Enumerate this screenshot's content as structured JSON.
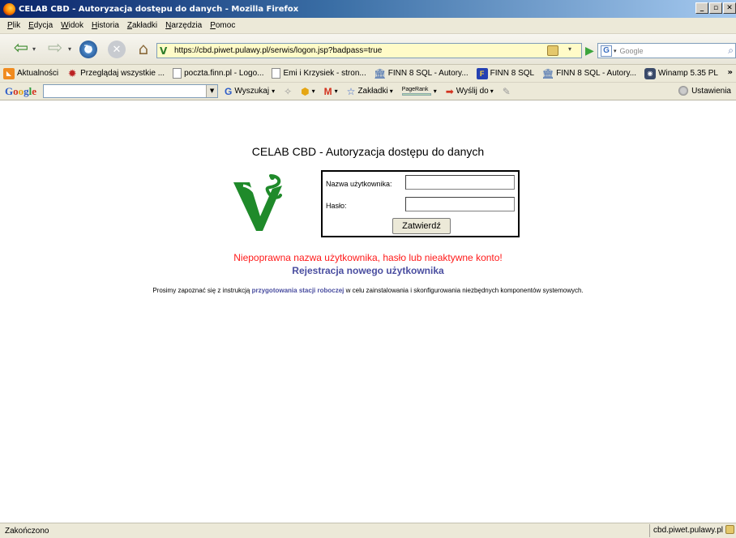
{
  "window": {
    "title": "CELAB CBD - Autoryzacja dostępu do danych - Mozilla Firefox",
    "controls": [
      "_",
      "▫",
      "✕"
    ]
  },
  "menu": [
    "Plik",
    "Edycja",
    "Widok",
    "Historia",
    "Zakładki",
    "Narzędzia",
    "Pomoc"
  ],
  "navigation": {
    "url": "https://cbd.piwet.pulawy.pl/serwis/logon.jsp?badpass=true",
    "search_placeholder": "Google",
    "icons": [
      "back-icon",
      "forward-icon",
      "reload-icon",
      "stop-icon",
      "home-icon",
      "go-icon"
    ]
  },
  "bookmarks": [
    {
      "label": "Aktualności",
      "icon": "rss"
    },
    {
      "label": "Przeglądaj wszystkie ...",
      "icon": "red"
    },
    {
      "label": "poczta.finn.pl - Logo...",
      "icon": "page"
    },
    {
      "label": "Emi i Krzysiek - stron...",
      "icon": "page"
    },
    {
      "label": "FINN 8 SQL - Autory...",
      "icon": "bank"
    },
    {
      "label": "FINN 8 SQL",
      "icon": "finn"
    },
    {
      "label": "FINN 8 SQL - Autory...",
      "icon": "bank"
    },
    {
      "label": "Winamp 5.35 PL",
      "icon": "winamp"
    }
  ],
  "google_toolbar": {
    "logo": "Google",
    "search_label": "Wyszukaj",
    "bookmarks_label": "Zakładki",
    "pagerank_label": "PageRank",
    "send_label": "Wyślij do",
    "settings_label": "Ustawienia"
  },
  "page": {
    "title": "CELAB CBD - Autoryzacja dostępu do danych",
    "username_label": "Nazwa użytkownika:",
    "password_label": "Hasło:",
    "username_value": "",
    "password_value": "",
    "submit_label": "Zatwierdź",
    "error_message": "Niepoprawna nazwa użytkownika, hasło lub nieaktywne konto!",
    "register_link": "Rejestracja nowego użytkownika",
    "instructions_before": "Prosimy zapoznać się z instrukcją ",
    "instructions_link": "przygotowania stacji roboczej",
    "instructions_after": " w celu zainstalowania i skonfigurowania niezbędnych komponentów systemowych."
  },
  "status": {
    "text": "Zakończono",
    "domain": "cbd.piwet.pulawy.pl"
  },
  "colors": {
    "error": "#ff1a1a",
    "link": "#4a4ea0",
    "logo_green": "#1f8a2a",
    "titlebar": "#0a246a"
  }
}
